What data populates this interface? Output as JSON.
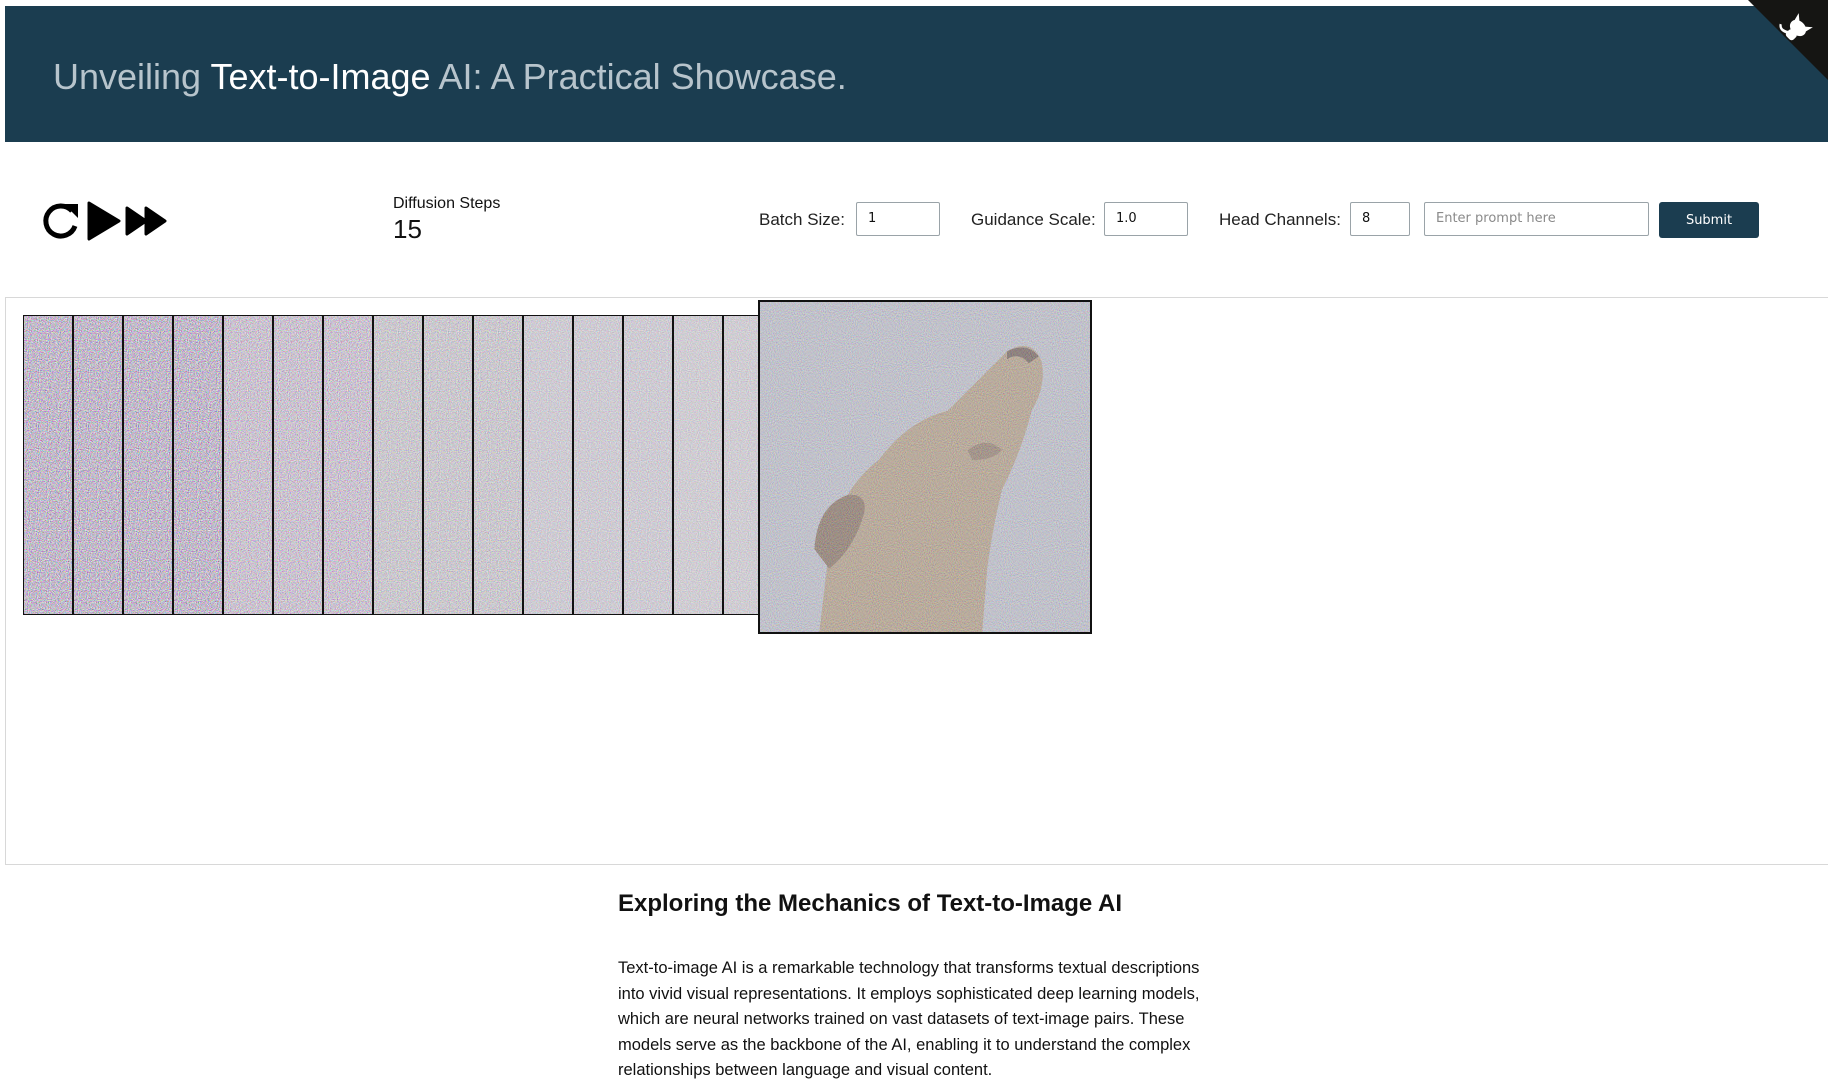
{
  "header": {
    "title_part1": "Unveiling ",
    "title_highlight": "Text-to-Image",
    "title_part2": " AI: A Practical Showcase.",
    "colors": {
      "background": "#1b3d50",
      "text_muted": "#b7c4cc",
      "text_highlight": "#ffffff"
    },
    "corner_icon": "github-octocat-icon"
  },
  "controls": {
    "icons": [
      "refresh-icon",
      "play-icon",
      "fast-forward-icon"
    ],
    "diffusion_steps_label": "Diffusion Steps",
    "diffusion_steps_value": "15",
    "batch_size_label": "Batch Size:",
    "batch_size_value": "1",
    "guidance_scale_label": "Guidance Scale:",
    "guidance_scale_value": "1.0",
    "head_channels_label": "Head Channels:",
    "head_channels_value": "8",
    "prompt_placeholder": "Enter prompt here",
    "submit_label": "Submit"
  },
  "article": {
    "heading": "Exploring the Mechanics of Text-to-Image AI",
    "body": "Text-to-image AI is a remarkable technology that transforms textual descriptions into vivid visual representations. It employs sophisticated deep learning models, which are neural networks trained on vast datasets of text-image pairs. These models serve as the backbone of the AI, enabling it to understand the complex relationships between language and visual content."
  }
}
